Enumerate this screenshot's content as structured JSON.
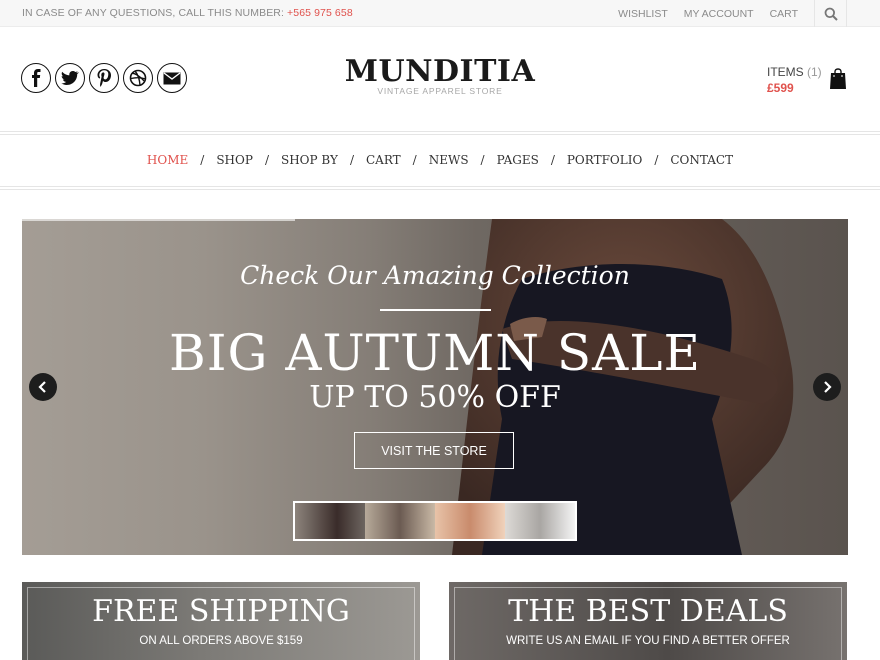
{
  "topbar": {
    "info_prefix": "IN CASE OF ANY QUESTIONS, CALL THIS NUMBER:",
    "phone": "+565 975 658",
    "links": [
      "WISHLIST",
      "MY ACCOUNT",
      "CART"
    ]
  },
  "header": {
    "brand": "MUNDITIA",
    "tagline": "VINTAGE APPAREL STORE",
    "social_icons": [
      "facebook-icon",
      "twitter-icon",
      "pinterest-icon",
      "dribbble-icon",
      "email-icon"
    ],
    "cart": {
      "items_label": "ITEMS",
      "items_count": "(1)",
      "total": "£599"
    }
  },
  "nav": {
    "items": [
      "HOME",
      "SHOP",
      "SHOP BY",
      "CART",
      "NEWS",
      "PAGES",
      "PORTFOLIO",
      "CONTACT"
    ],
    "active": "HOME"
  },
  "hero": {
    "script_title": "Check Our Amazing Collection",
    "headline": "BIG AUTUMN SALE",
    "subheadline": "UP TO 50% OFF",
    "cta": "VISIT THE STORE"
  },
  "banners": [
    {
      "title": "FREE SHIPPING",
      "subtitle": "ON ALL ORDERS ABOVE $159"
    },
    {
      "title": "THE BEST DEALS",
      "subtitle": "WRITE US AN EMAIL IF YOU FIND A BETTER OFFER"
    }
  ],
  "colors": {
    "accent": "#e0524d",
    "text": "#333333",
    "muted": "#8a8a8a"
  }
}
